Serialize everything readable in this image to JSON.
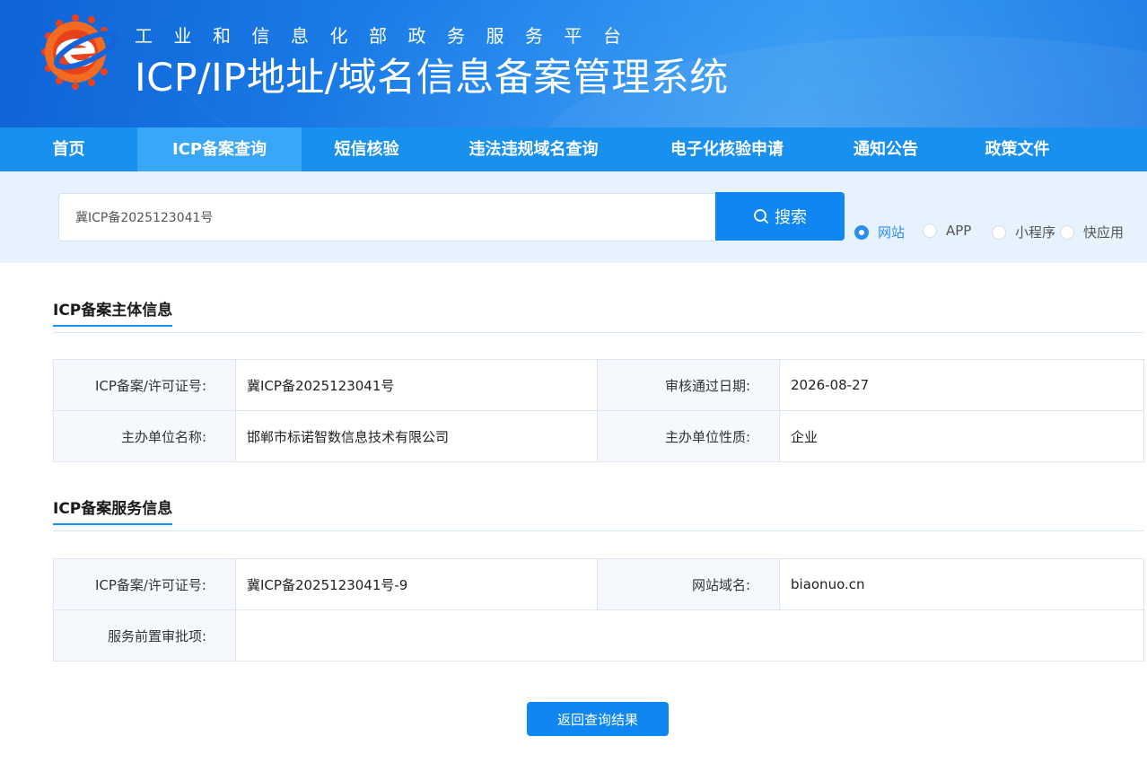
{
  "header": {
    "subtitle": "工业和信息化部政务服务平台",
    "title": "ICP/IP地址/域名信息备案管理系统",
    "colors": {
      "banner": "#1f86ee",
      "accent": "#0f86f2"
    }
  },
  "nav": {
    "items": [
      {
        "label": "首页",
        "active": false
      },
      {
        "label": "ICP备案查询",
        "active": true
      },
      {
        "label": "短信核验",
        "active": false
      },
      {
        "label": "违法违规域名查询",
        "active": false
      },
      {
        "label": "电子化核验申请",
        "active": false
      },
      {
        "label": "通知公告",
        "active": false
      },
      {
        "label": "政策文件",
        "active": false
      }
    ]
  },
  "search": {
    "value": "冀ICP备2025123041号",
    "button_label": "搜索",
    "button_icon": "search-icon",
    "types": [
      {
        "label": "网站",
        "checked": true
      },
      {
        "label": "APP",
        "checked": false
      },
      {
        "label": "小程序",
        "checked": false
      },
      {
        "label": "快应用",
        "checked": false
      }
    ]
  },
  "subject": {
    "title": "ICP备案主体信息",
    "rows": [
      {
        "k1": "ICP备案/许可证号:",
        "v1": "冀ICP备2025123041号",
        "k2": "审核通过日期:",
        "v2": "2026-08-27"
      },
      {
        "k1": "主办单位名称:",
        "v1": "邯郸市标诺智数信息技术有限公司",
        "k2": "主办单位性质:",
        "v2": "企业"
      }
    ]
  },
  "service": {
    "title": "ICP备案服务信息",
    "row1": {
      "k1": "ICP备案/许可证号:",
      "v1": "冀ICP备2025123041号-9",
      "k2": "网站域名:",
      "v2": "biaonuo.cn"
    },
    "row2": {
      "k1": "服务前置审批项:",
      "v1": ""
    }
  },
  "back_button": "返回查询结果"
}
